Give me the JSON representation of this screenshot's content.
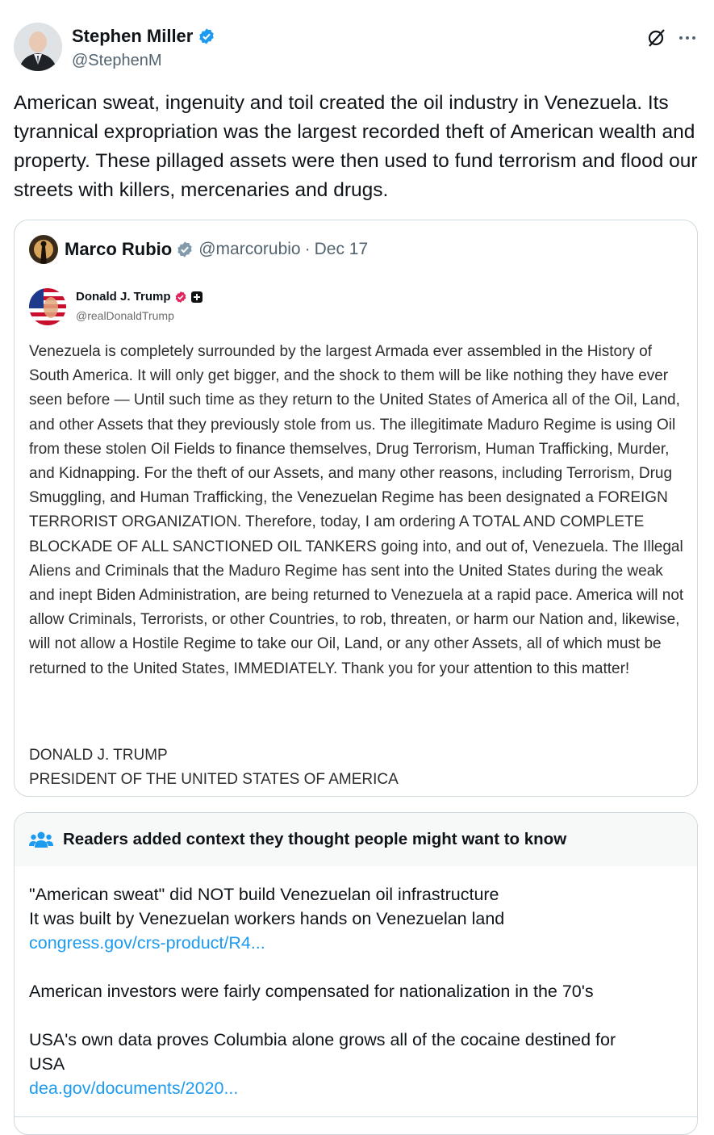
{
  "author": {
    "name": "Stephen Miller",
    "handle": "@StephenM",
    "verified_color": "#1d9bf0"
  },
  "tweet": {
    "text": "American sweat, ingenuity and toil created the oil industry in Venezuela. Its tyrannical expropriation was the largest recorded theft of American wealth and property. These pillaged assets were then used to fund terrorism and flood our streets with killers, mercenaries and drugs."
  },
  "quote": {
    "author_name": "Marco Rubio",
    "author_handle": "@marcorubio",
    "separator": "·",
    "date": "Dec 17",
    "verified_color": "#829aab",
    "embedded": {
      "name": "Donald J. Trump",
      "handle": "@realDonaldTrump",
      "badge_color": "#e0245e",
      "body": "Venezuela is completely surrounded by the largest Armada ever assembled in the History of South America. It will only get bigger, and the shock to them will be like nothing they have ever seen before — Until such time as they return to the United States of America all of the Oil, Land, and other Assets that they previously stole from us. The illegitimate Maduro Regime is using Oil from these stolen Oil Fields to finance themselves, Drug Terrorism, Human Trafficking, Murder, and Kidnapping. For the theft of our Assets, and many other reasons, including Terrorism, Drug Smuggling, and Human Trafficking, the Venezuelan Regime has been designated a FOREIGN TERRORIST ORGANIZATION. Therefore, today, I am ordering A TOTAL AND COMPLETE BLOCKADE OF ALL SANCTIONED OIL TANKERS going into, and out of, Venezuela. The Illegal Aliens and Criminals that the Maduro Regime has sent into the United States during the weak and inept Biden Administration, are being returned to Venezuela at a rapid pace. America will not allow Criminals, Terrorists, or other Countries, to rob, threaten, or harm our Nation and, likewise, will not allow a Hostile Regime to take our Oil, Land, or any other Assets, all of which must be returned to the United States, IMMEDIATELY. Thank you for your attention to this matter!",
      "signature_line1": "DONALD J. TRUMP",
      "signature_line2": "PRESIDENT OF THE UNITED STATES OF AMERICA"
    }
  },
  "community_note": {
    "title": "Readers added context they thought people might want to know",
    "icon": "people-icon",
    "icon_color": "#1d9bf0",
    "lines": [
      "\"American sweat\" did NOT build Venezuelan oil infrastructure",
      "It was built by Venezuelan workers hands on Venezuelan land"
    ],
    "link1": "congress.gov/crs-product/R4...",
    "paragraph2": "American investors were fairly compensated for nationalization in the 70's",
    "paragraph3_line1": "USA's own data proves Columbia alone grows all of the cocaine destined for",
    "paragraph3_line2": "USA",
    "link2": "dea.gov/documents/2020..."
  }
}
